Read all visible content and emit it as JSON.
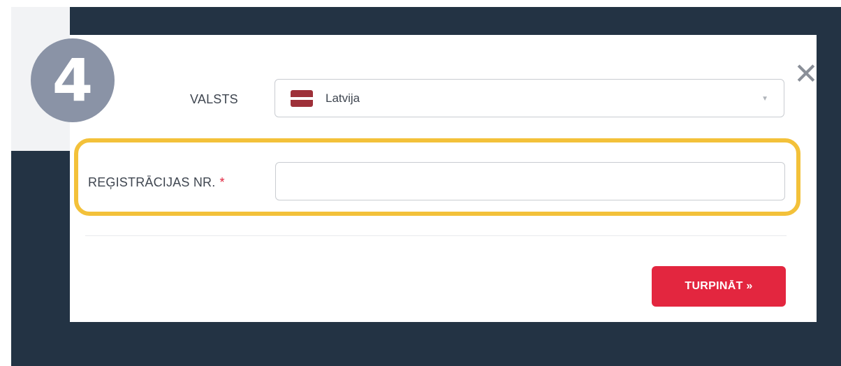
{
  "step_badge": "4",
  "close_icon": "close-icon",
  "form": {
    "country_label": "VALSTS",
    "country_value": "Latvija",
    "country_flag": {
      "icon": "latvia-flag-icon",
      "color": "#9e3039"
    },
    "registration_label": "REĢISTRĀCIJAS NR.",
    "registration_required_mark": "*",
    "registration_value": "",
    "registration_placeholder": ""
  },
  "actions": {
    "continue_label": "TURPINĀT »"
  },
  "colors": {
    "backdrop": "#233344",
    "highlight": "#f3c13a",
    "accent": "#e3263f",
    "badge": "#8a93a6"
  }
}
